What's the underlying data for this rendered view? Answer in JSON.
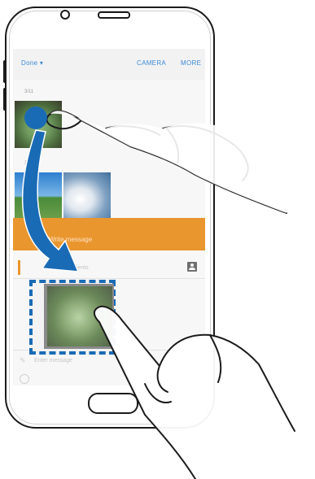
{
  "app_bar": {
    "title": "Done ▾",
    "actions": [
      "CAMERA",
      "MORE"
    ]
  },
  "gallery": {
    "section_1_label": "3/11",
    "section_2_label": "3/9",
    "banner_text": "Write message"
  },
  "messages": {
    "recipient_hint": "Recipients",
    "compose_hint": "Enter message"
  },
  "colors": {
    "accent_blue": "#1a6bb5",
    "banner_orange": "#ea962f",
    "topbar_link": "#3b8ad6"
  },
  "icons": {
    "contact": "contact-icon",
    "attach": "attach-icon",
    "emoji": "emoji-icon",
    "multiwindow": "multiwindow-icon"
  }
}
